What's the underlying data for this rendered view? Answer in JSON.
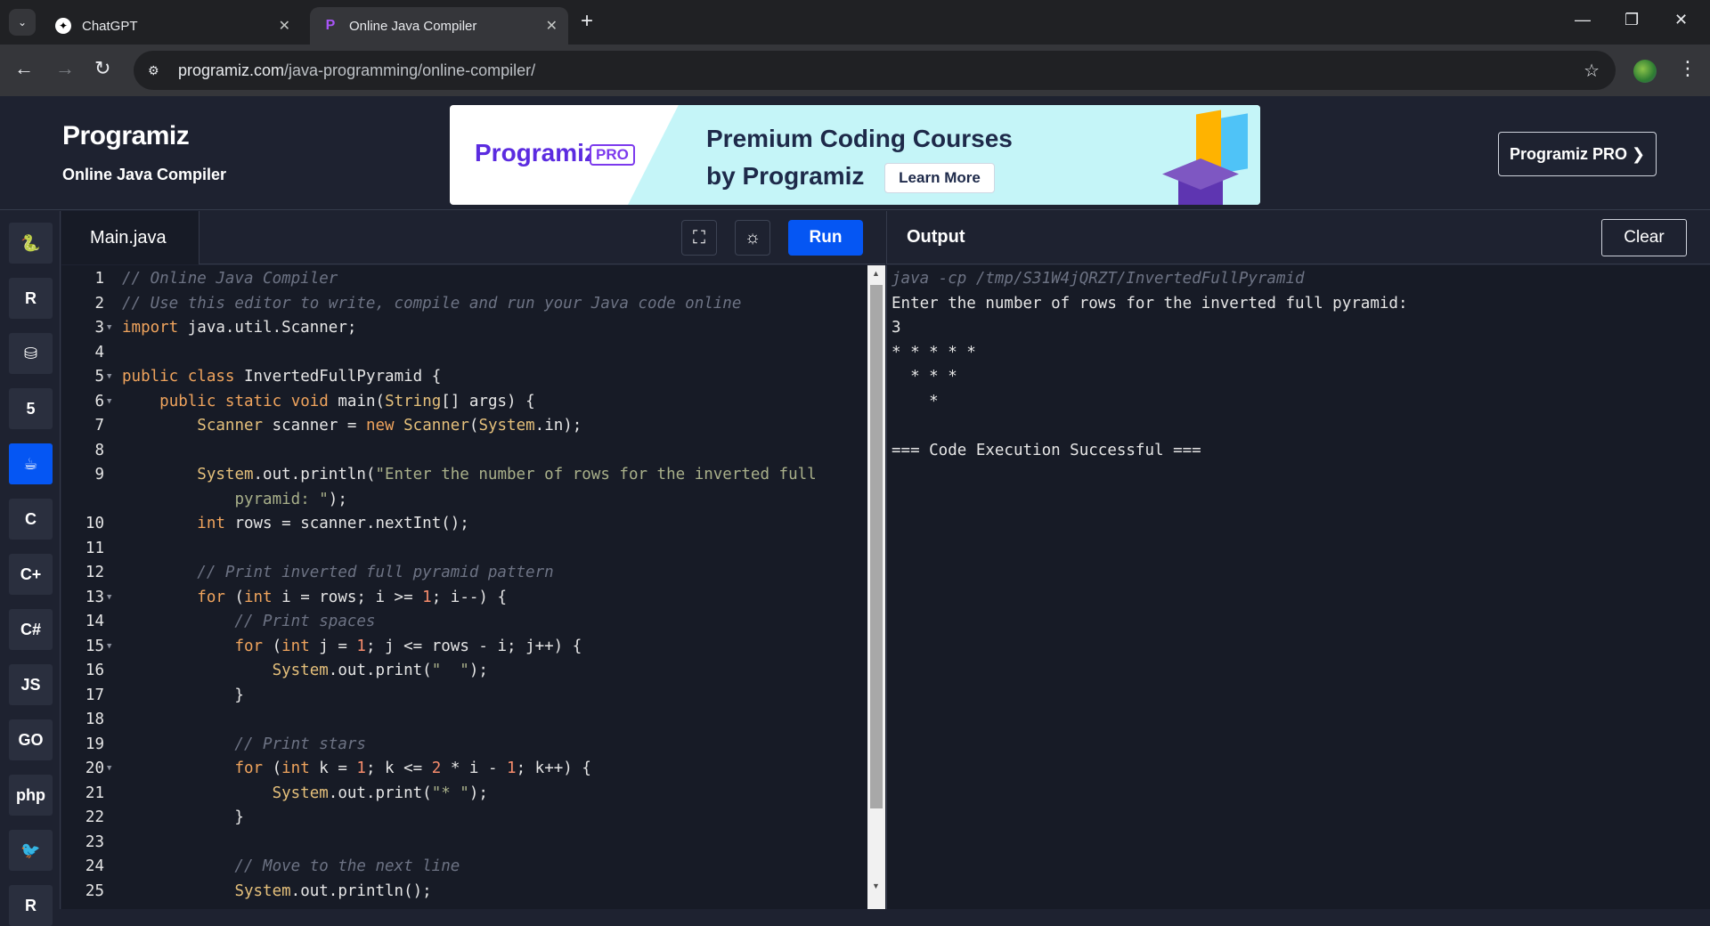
{
  "browser": {
    "tabs": [
      {
        "title": "ChatGPT",
        "icon": "chatgpt-icon",
        "active": false
      },
      {
        "title": "Online Java Compiler",
        "icon": "programiz-icon",
        "active": true
      }
    ],
    "url_domain": "programiz.com",
    "url_path": "/java-programming/online-compiler/"
  },
  "header": {
    "logo": "Programiz",
    "subtitle": "Online Java Compiler",
    "banner": {
      "brand": "Programiz",
      "pro_tag": "PRO",
      "headline_1": "Premium Coding Courses",
      "headline_2": "by Programiz",
      "cta": "Learn More"
    },
    "pro_button": "Programiz PRO ❯"
  },
  "languages": [
    {
      "name": "python-icon",
      "glyph": "🐍"
    },
    {
      "name": "r-icon",
      "glyph": "R"
    },
    {
      "name": "sql-icon",
      "glyph": "⛁"
    },
    {
      "name": "html-icon",
      "glyph": "5"
    },
    {
      "name": "java-icon",
      "glyph": "☕",
      "active": true
    },
    {
      "name": "c-icon",
      "glyph": "C"
    },
    {
      "name": "cplusplus-icon",
      "glyph": "C+"
    },
    {
      "name": "csharp-icon",
      "glyph": "C#"
    },
    {
      "name": "javascript-icon",
      "glyph": "JS"
    },
    {
      "name": "go-icon",
      "glyph": "GO"
    },
    {
      "name": "php-icon",
      "glyph": "php"
    },
    {
      "name": "swift-icon",
      "glyph": "🐦"
    },
    {
      "name": "rust-icon",
      "glyph": "R"
    }
  ],
  "editor": {
    "file_name": "Main.java",
    "run_label": "Run",
    "lines": [
      {
        "n": "1",
        "fold": false,
        "text": "// Online Java Compiler"
      },
      {
        "n": "2",
        "fold": false,
        "text": "// Use this editor to write, compile and run your Java code online"
      },
      {
        "n": "3",
        "fold": true,
        "text": "import java.util.Scanner;"
      },
      {
        "n": "4",
        "fold": false,
        "text": ""
      },
      {
        "n": "5",
        "fold": true,
        "text": "public class InvertedFullPyramid {"
      },
      {
        "n": "6",
        "fold": true,
        "text": "    public static void main(String[] args) {"
      },
      {
        "n": "7",
        "fold": false,
        "text": "        Scanner scanner = new Scanner(System.in);"
      },
      {
        "n": "8",
        "fold": false,
        "text": ""
      },
      {
        "n": "9",
        "fold": false,
        "text": "        System.out.println(\"Enter the number of rows for the inverted full"
      },
      {
        "n": "",
        "fold": false,
        "text": "            pyramid: \");"
      },
      {
        "n": "10",
        "fold": false,
        "text": "        int rows = scanner.nextInt();"
      },
      {
        "n": "11",
        "fold": false,
        "text": ""
      },
      {
        "n": "12",
        "fold": false,
        "text": "        // Print inverted full pyramid pattern"
      },
      {
        "n": "13",
        "fold": true,
        "text": "        for (int i = rows; i >= 1; i--) {"
      },
      {
        "n": "14",
        "fold": false,
        "text": "            // Print spaces"
      },
      {
        "n": "15",
        "fold": true,
        "text": "            for (int j = 1; j <= rows - i; j++) {"
      },
      {
        "n": "16",
        "fold": false,
        "text": "                System.out.print(\"  \");"
      },
      {
        "n": "17",
        "fold": false,
        "text": "            }"
      },
      {
        "n": "18",
        "fold": false,
        "text": ""
      },
      {
        "n": "19",
        "fold": false,
        "text": "            // Print stars"
      },
      {
        "n": "20",
        "fold": true,
        "text": "            for (int k = 1; k <= 2 * i - 1; k++) {"
      },
      {
        "n": "21",
        "fold": false,
        "text": "                System.out.print(\"* \");"
      },
      {
        "n": "22",
        "fold": false,
        "text": "            }"
      },
      {
        "n": "23",
        "fold": false,
        "text": ""
      },
      {
        "n": "24",
        "fold": false,
        "text": "            // Move to the next line"
      },
      {
        "n": "25",
        "fold": false,
        "text": "            System.out.println();"
      }
    ]
  },
  "output": {
    "title": "Output",
    "clear_label": "Clear",
    "lines": [
      {
        "kind": "cmd",
        "text": "java -cp /tmp/S31W4jQRZT/InvertedFullPyramid"
      },
      {
        "kind": "out",
        "text": "Enter the number of rows for the inverted full pyramid:"
      },
      {
        "kind": "out",
        "text": "3"
      },
      {
        "kind": "out",
        "text": "* * * * *"
      },
      {
        "kind": "out",
        "text": "  * * *"
      },
      {
        "kind": "out",
        "text": "    *"
      },
      {
        "kind": "out",
        "text": ""
      },
      {
        "kind": "out",
        "text": "=== Code Execution Successful ==="
      }
    ]
  }
}
